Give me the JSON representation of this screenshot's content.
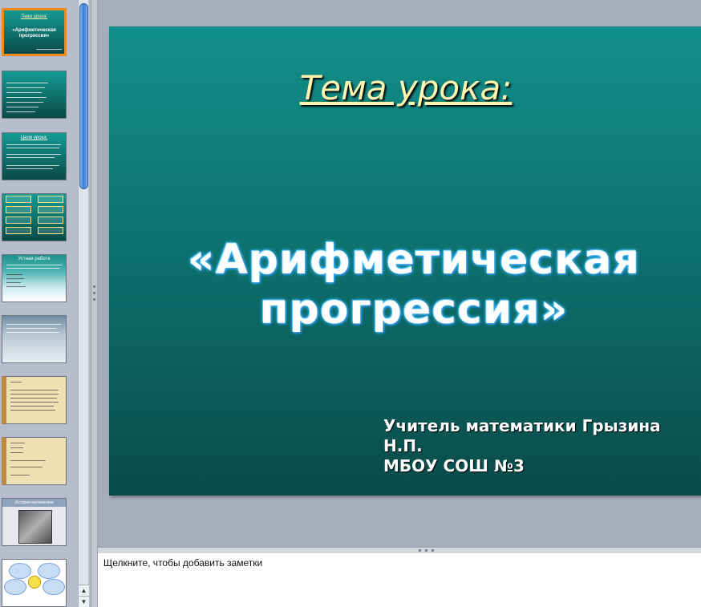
{
  "slide": {
    "subtitle": "Тема  урока:",
    "title_line1": "«Арифметическая",
    "title_line2": "прогрессия»",
    "author_line1": "Учитель математики Грызина Н.П.",
    "author_line2": "МБОУ СОШ №3"
  },
  "thumbnails": {
    "t1_line1": "Тема  урока:",
    "t1_line2": "«Арифметическая",
    "t1_line3": "прогрессия»",
    "t3_title": "Цели урока:",
    "t5_title": "Устная работа",
    "t9_title": "История математики"
  },
  "notes": {
    "placeholder": "Щелкните, чтобы добавить заметки"
  },
  "scrollbar": {
    "up": "▲",
    "down": "▼"
  },
  "colors": {
    "slide_bg": "#0d6f6c",
    "subtitle_color": "#fff5b0",
    "active_thumb_border": "#f08a1c",
    "scroll_thumb": "#3b7fd4"
  }
}
